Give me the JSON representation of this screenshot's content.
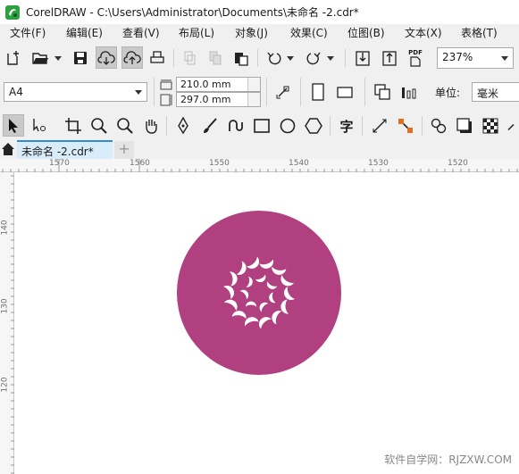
{
  "window": {
    "title": "CorelDRAW - C:\\Users\\Administrator\\Documents\\未命名 -2.cdr*"
  },
  "menu": [
    {
      "label": "文件(F)"
    },
    {
      "label": "编辑(E)"
    },
    {
      "label": "查看(V)"
    },
    {
      "label": "布局(L)"
    },
    {
      "label": "对象(J)"
    },
    {
      "label": "效果(C)"
    },
    {
      "label": "位图(B)"
    },
    {
      "label": "文本(X)"
    },
    {
      "label": "表格(T)"
    }
  ],
  "standard_toolbar": {
    "zoom_value": "237%",
    "pdf_label": "PDF"
  },
  "property_bar": {
    "page_size": "A4",
    "width_value": "210.0 mm",
    "height_value": "297.0 mm",
    "units_label": "单位:",
    "units_value": "毫米"
  },
  "toolbox": {
    "text_tool_glyph": "字"
  },
  "tabs": {
    "document_tab": "未命名 -2.cdr*",
    "add_tab": "+"
  },
  "rulers": {
    "horizontal_labels": [
      "1570",
      "1560",
      "1550",
      "1540",
      "1530",
      "1520"
    ],
    "vertical_labels": [
      "140",
      "130",
      "120"
    ]
  },
  "artwork": {
    "circle_color": "#b0407f",
    "petal_color": "#ffffff",
    "petal_count": 14,
    "inner_petal_count": 7
  },
  "watermark": {
    "text": "软件自学网：RJZXW.COM"
  },
  "colors": {
    "accent": "#2f8bd8",
    "tab_bg": "#d9ecfa"
  }
}
